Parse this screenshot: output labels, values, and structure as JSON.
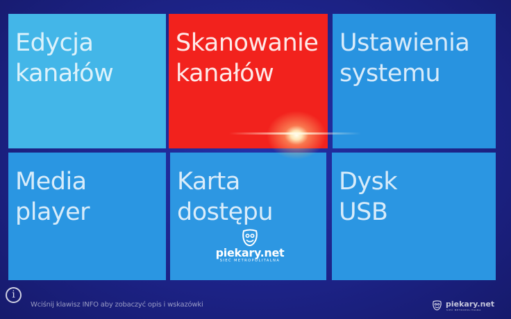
{
  "menu": {
    "tiles": [
      {
        "line1": "Edycja",
        "line2": "kanałów",
        "color": "#43b6e8"
      },
      {
        "line1": "Skanowanie",
        "line2": "kanałów",
        "color": "#f2221d"
      },
      {
        "line1": "Ustawienia",
        "line2": "systemu",
        "color": "#2893e0"
      },
      {
        "line1": "Media",
        "line2": "player",
        "color": "#2a96e2"
      },
      {
        "line1": "Karta",
        "line2": "dostępu",
        "color": "#2d97e2"
      },
      {
        "line1": "Dysk",
        "line2": "USB",
        "color": "#2b96e2"
      }
    ]
  },
  "watermark": {
    "brand": "piekary.net",
    "tagline": "SIEĆ METROPOLITALNA"
  },
  "footer": {
    "info_icon": "info-circle-icon",
    "hint": "Wciśnij klawisz INFO aby zobaczyć opis i wskazówki",
    "brand": "piekary.net",
    "tagline": "SIEĆ METROPOLITALNA"
  }
}
